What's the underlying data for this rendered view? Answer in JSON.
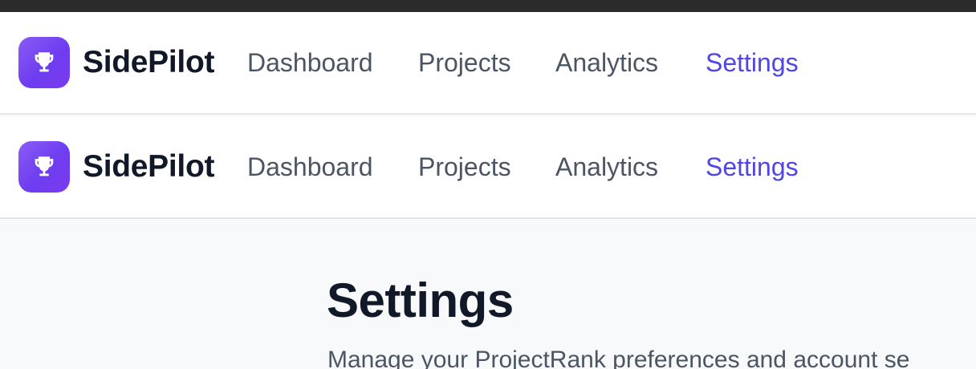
{
  "app": {
    "brand": "SidePilot",
    "logo_icon": "trophy-icon",
    "accent_color": "#4f46e5",
    "logo_gradient": [
      "#8b5cf6",
      "#7c3aed"
    ]
  },
  "navbars": [
    {
      "links": [
        {
          "label": "Dashboard",
          "active": false
        },
        {
          "label": "Projects",
          "active": false
        },
        {
          "label": "Analytics",
          "active": false
        },
        {
          "label": "Settings",
          "active": true
        }
      ]
    },
    {
      "links": [
        {
          "label": "Dashboard",
          "active": false
        },
        {
          "label": "Projects",
          "active": false
        },
        {
          "label": "Analytics",
          "active": false
        },
        {
          "label": "Settings",
          "active": true
        }
      ]
    }
  ],
  "page": {
    "title": "Settings",
    "subtitle": "Manage your ProjectRank preferences and account se"
  }
}
